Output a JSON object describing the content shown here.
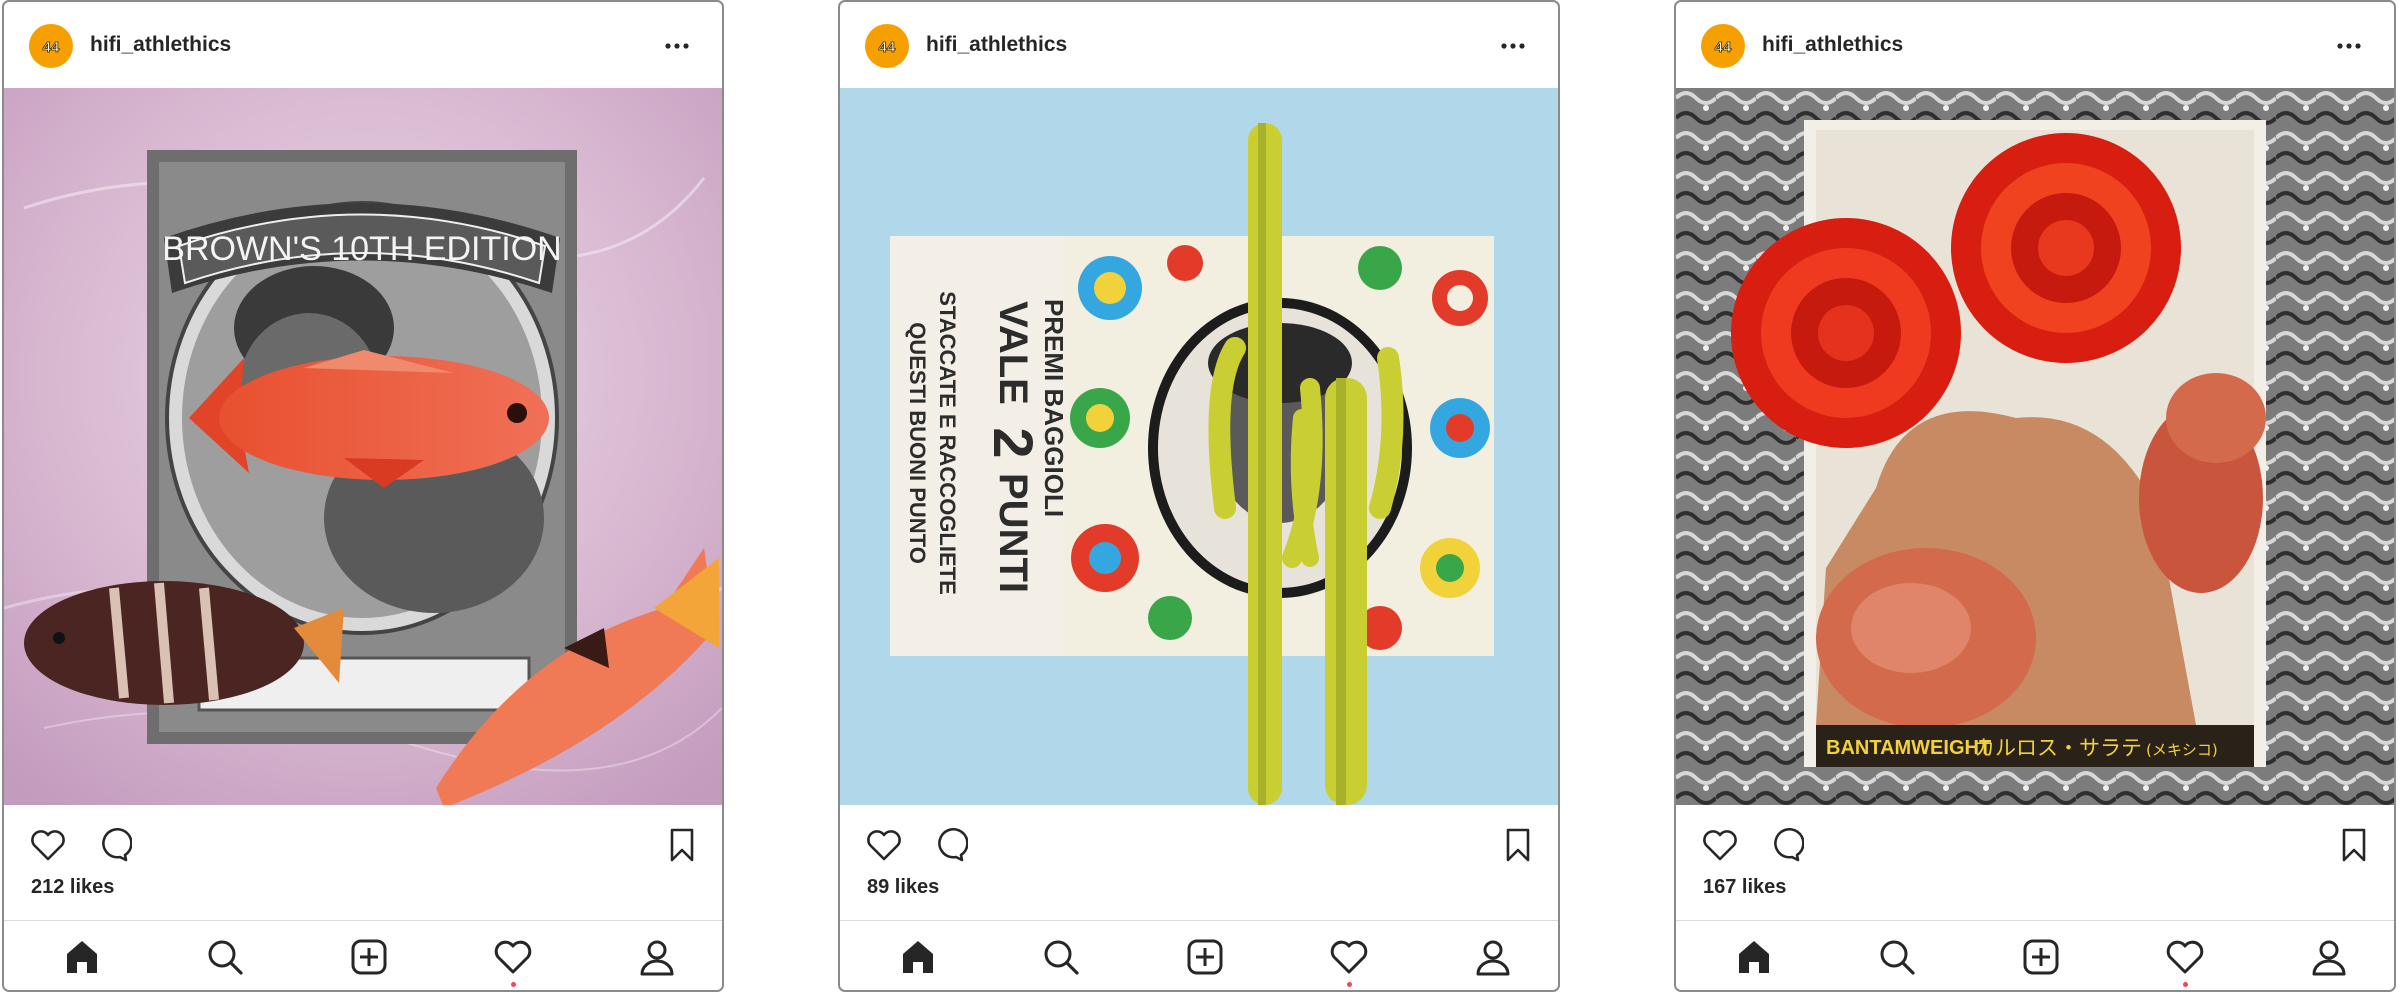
{
  "posts": [
    {
      "username": "hifi_athlethics",
      "likes": "212 likes",
      "photo_text": {
        "banner": "BROWN'S 10TH EDITION"
      }
    },
    {
      "username": "hifi_athlethics",
      "likes": "89 likes",
      "photo_text": {
        "line1": "PREMI BAGGIOLI",
        "line2_a": "VALE",
        "line2_num": "2",
        "line2_b": "PUNTI",
        "line3": "STACCATE E RACCOGLIETE",
        "line4": "QUESTI BUONI PUNTO"
      }
    },
    {
      "username": "hifi_athlethics",
      "likes": "167 likes",
      "photo_text": {
        "caption_en": "BANTAMWEIGHT",
        "caption_jp": "カルロス・サラテ",
        "caption_jp_small": "(メキシコ)"
      }
    }
  ],
  "icons": {
    "avatar": "hifi-logo-icon",
    "more": "more-options-icon",
    "like": "heart-icon",
    "comment": "comment-icon",
    "save": "bookmark-icon",
    "nav": [
      "home-icon",
      "search-icon",
      "new-post-icon",
      "activity-heart-icon",
      "profile-icon"
    ]
  },
  "colors": {
    "avatar_bg": "#f5a000",
    "notification_dot": "#ed4956",
    "text": "#262626"
  }
}
